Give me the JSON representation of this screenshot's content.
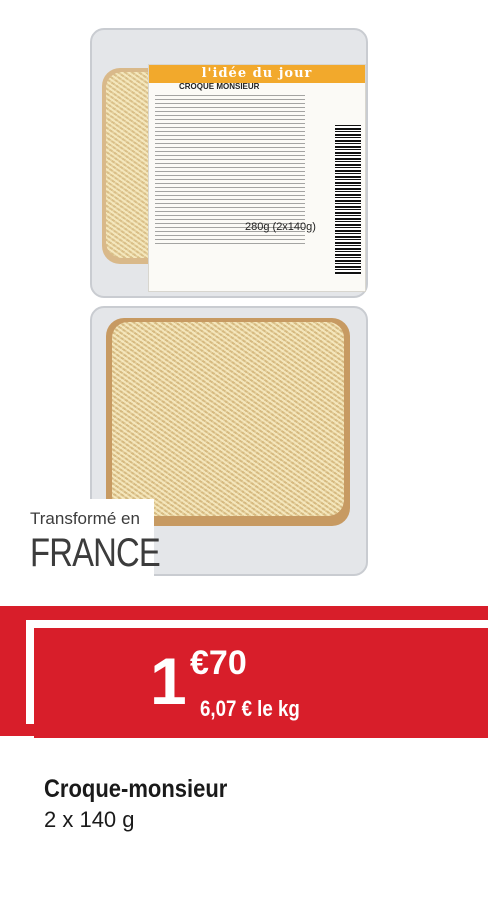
{
  "product_image": {
    "brand": "l'idée du jour",
    "label_name": "CROQUE MONSIEUR",
    "label_weight": "280g (2x140g)"
  },
  "origin": {
    "line1": "Transformé en",
    "line2": "FRANCE"
  },
  "price": {
    "integer": "1",
    "decimal": "€70",
    "per_kg": "6,07 € le kg"
  },
  "product": {
    "title": "Croque-monsieur",
    "subtitle": "2 x 140 g"
  },
  "colors": {
    "accent_red": "#d81e2a"
  }
}
